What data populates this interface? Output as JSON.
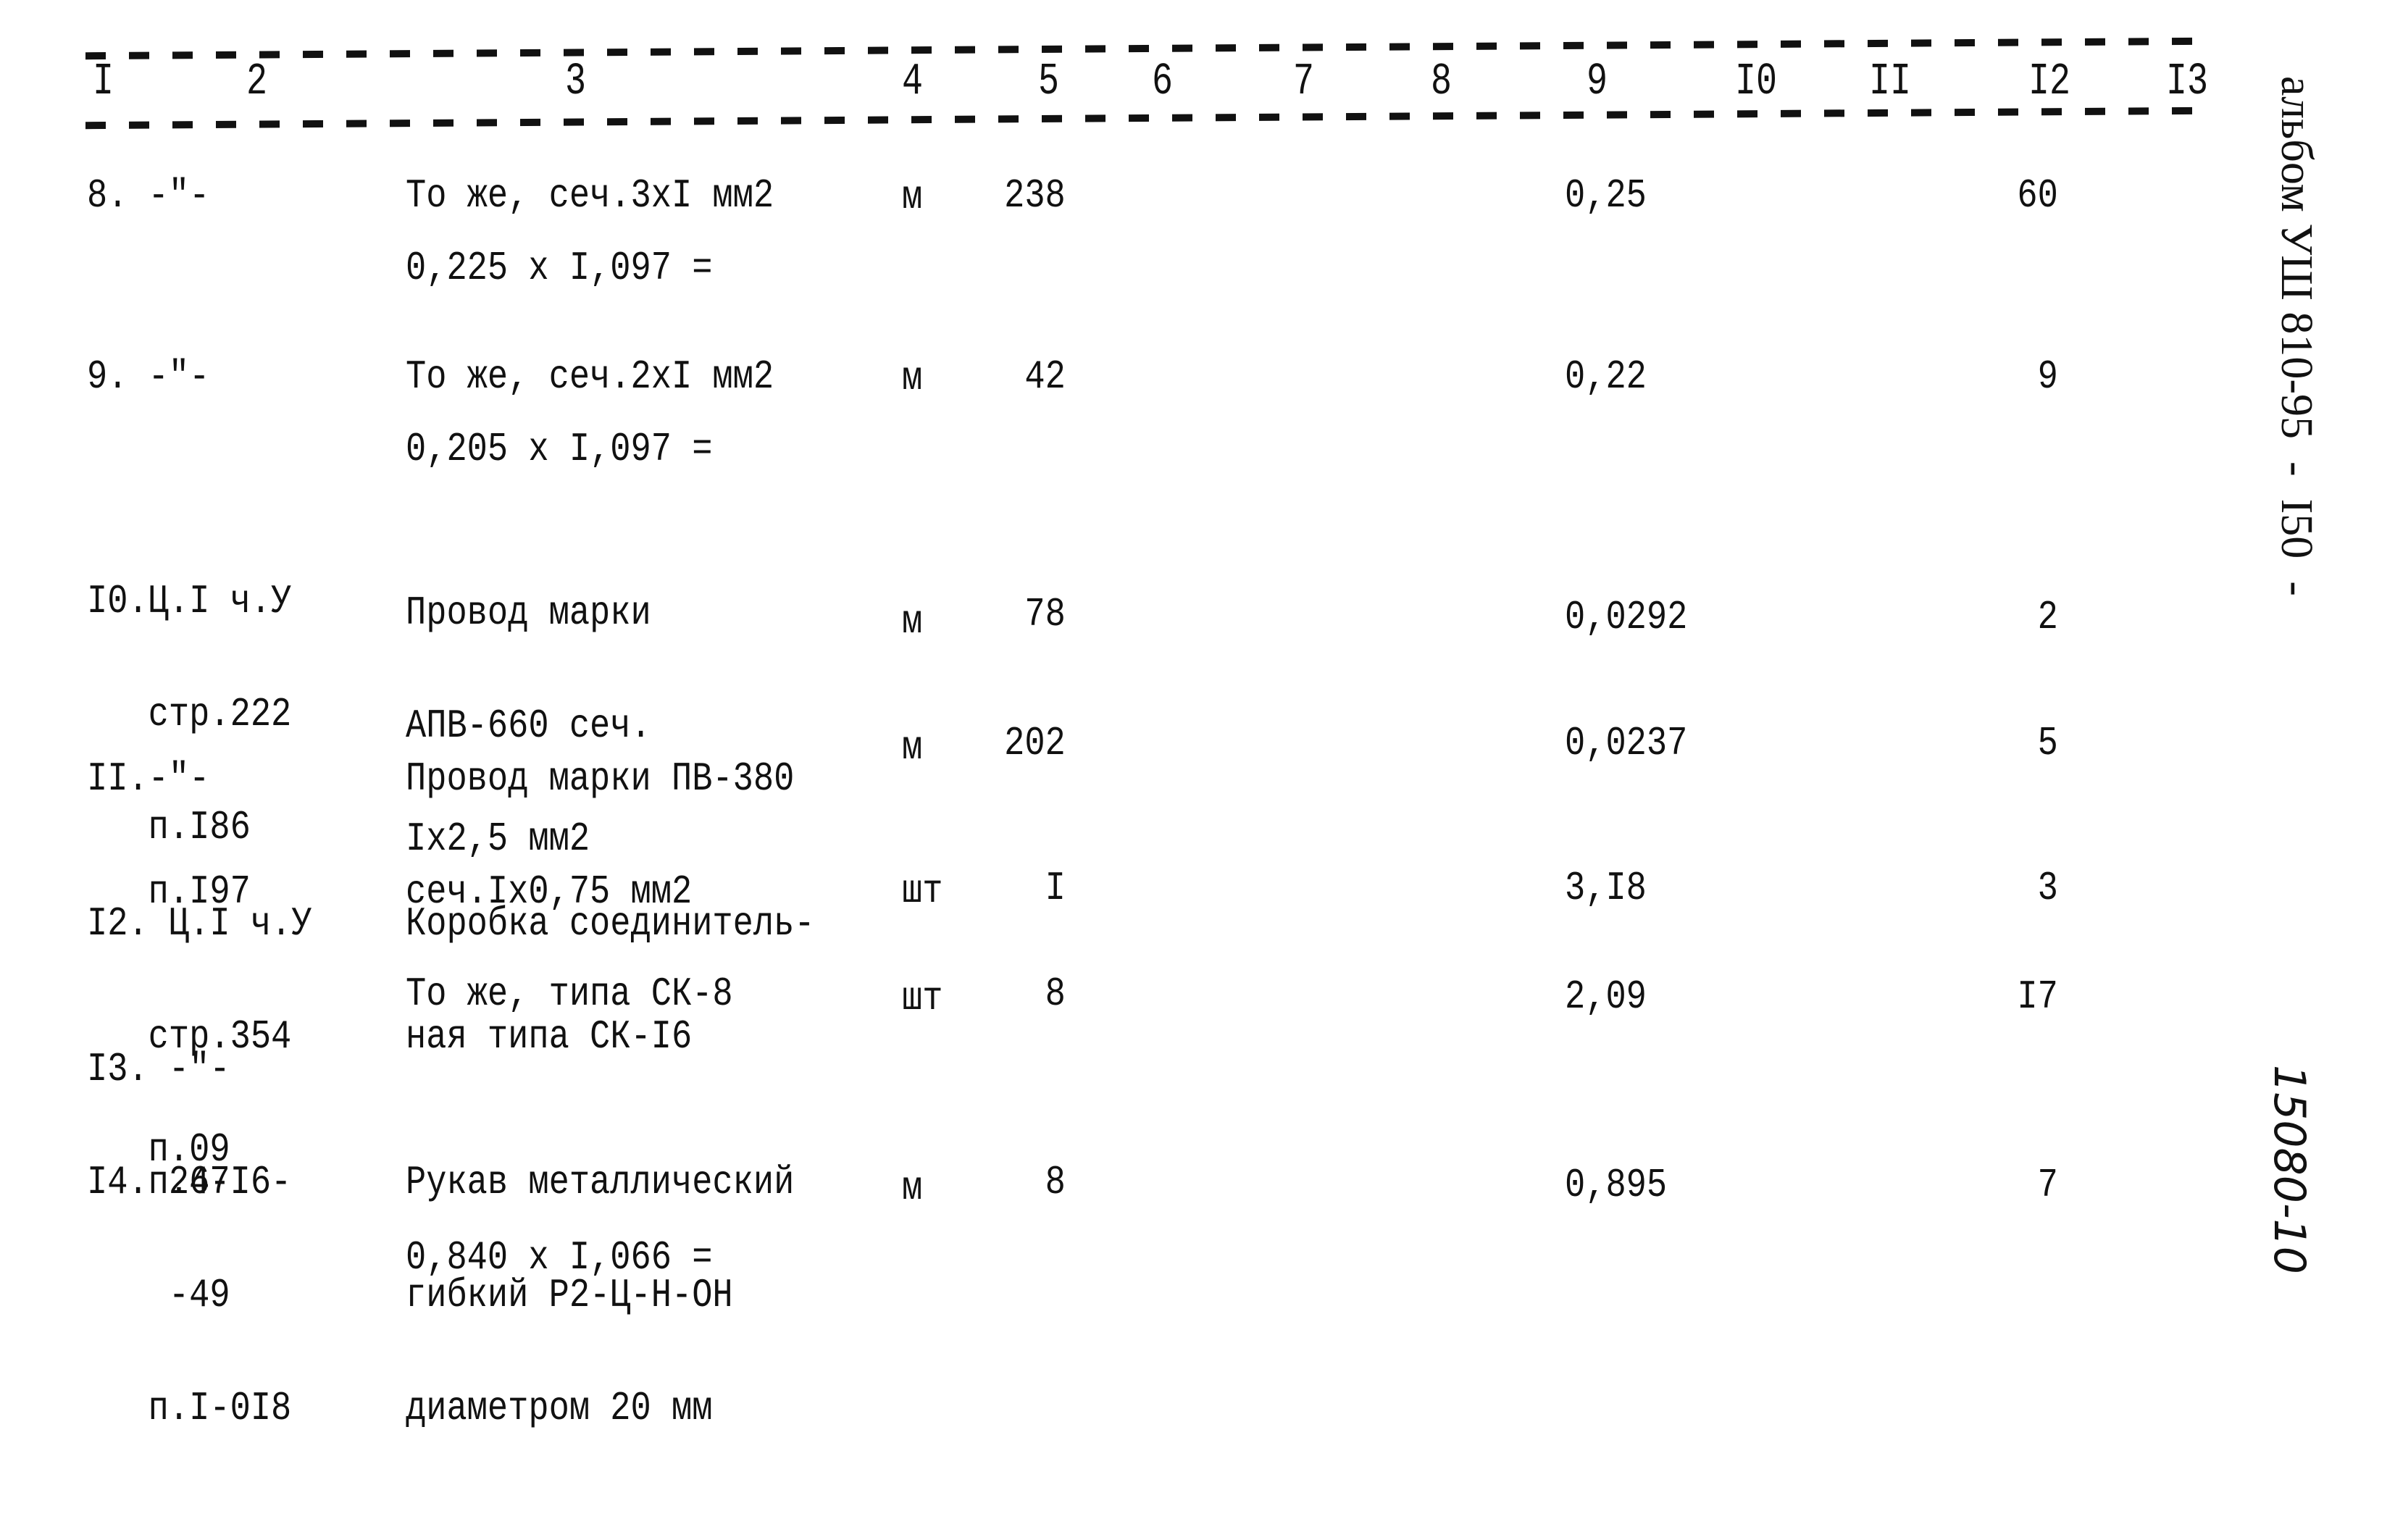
{
  "header": {
    "columns": [
      "I",
      "2",
      "3",
      "4",
      "5",
      "6",
      "7",
      "8",
      "9",
      "I0",
      "II",
      "I2",
      "I3"
    ]
  },
  "rows": [
    {
      "num_ref": [
        "8. -\"-"
      ],
      "description": [
        "То же, сеч.3хI мм2"
      ],
      "formula": "0,225 х I,097 =",
      "unit": "м",
      "quantity": "238",
      "col9": "0,25",
      "col12": "60"
    },
    {
      "num_ref": [
        "9. -\"-"
      ],
      "description": [
        "То же, сеч.2хI мм2"
      ],
      "formula": "0,205 х I,097 =",
      "unit": "м",
      "quantity": "42",
      "col9": "0,22",
      "col12": "9"
    },
    {
      "num_ref": [
        "I0.Ц.I ч.У",
        "   стр.222",
        "   п.I86"
      ],
      "description": [
        "Провод марки",
        "АПВ-660 сеч.",
        "Iх2,5 мм2"
      ],
      "formula": "",
      "unit": "м",
      "quantity": "78",
      "col9": "0,0292",
      "col12": "2"
    },
    {
      "num_ref": [
        "II.-\"-",
        "   п.I97"
      ],
      "description": [
        "Провод марки ПВ-380",
        "сеч.Iх0,75 мм2"
      ],
      "formula": "",
      "unit": "м",
      "quantity": "202",
      "col9": "0,0237",
      "col12": "5"
    },
    {
      "num_ref": [
        "I2. Ц.I ч.У",
        "   стр.354",
        "   п.09"
      ],
      "description": [
        "Коробка соединитель-",
        "ная типа СК-I6"
      ],
      "formula": "",
      "unit": "шт",
      "quantity": "I",
      "col9": "3,I8",
      "col12": "3"
    },
    {
      "num_ref": [
        "I3. -\"-",
        "   п.67"
      ],
      "description": [
        "То же, типа СК-8"
      ],
      "formula": "",
      "unit": "шт",
      "quantity": "8",
      "col9": "2,09",
      "col12": "I7"
    },
    {
      "num_ref": [
        "I4. 24-I6-",
        "    -49",
        "   п.I-0I8"
      ],
      "description": [
        "Рукав металлический",
        "гибкий Р2-Ц-Н-ОН",
        "диаметром 20 мм"
      ],
      "formula": "0,840 х I,066 =",
      "unit": "м",
      "quantity": "8",
      "col9": "0,895",
      "col12": "7"
    }
  ],
  "margin": {
    "album_stamp": "альбом УШ 810-95  -  I50  -",
    "handwritten_code": "15080-10"
  }
}
